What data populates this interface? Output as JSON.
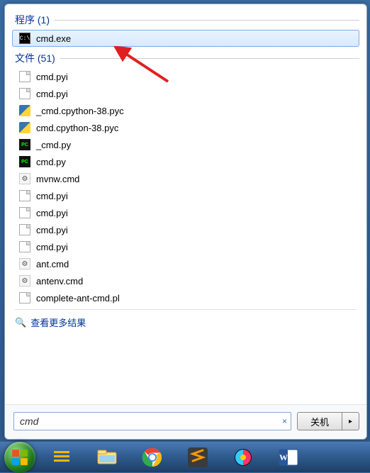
{
  "sections": {
    "programs": {
      "label": "程序 (1)"
    },
    "files": {
      "label": "文件 (51)"
    }
  },
  "programs_list": [
    {
      "name": "cmd.exe",
      "icon": "cmd",
      "selected": true
    }
  ],
  "files_list": [
    {
      "name": "cmd.pyi",
      "icon": "file"
    },
    {
      "name": "cmd.pyi",
      "icon": "file"
    },
    {
      "name": "_cmd.cpython-38.pyc",
      "icon": "py"
    },
    {
      "name": "cmd.cpython-38.pyc",
      "icon": "py"
    },
    {
      "name": "_cmd.py",
      "icon": "pc"
    },
    {
      "name": "cmd.py",
      "icon": "pc"
    },
    {
      "name": "mvnw.cmd",
      "icon": "gear"
    },
    {
      "name": "cmd.pyi",
      "icon": "file"
    },
    {
      "name": "cmd.pyi",
      "icon": "file"
    },
    {
      "name": "cmd.pyi",
      "icon": "file"
    },
    {
      "name": "cmd.pyi",
      "icon": "file"
    },
    {
      "name": "ant.cmd",
      "icon": "gear"
    },
    {
      "name": "antenv.cmd",
      "icon": "gear"
    },
    {
      "name": "complete-ant-cmd.pl",
      "icon": "file"
    }
  ],
  "see_more_label": "查看更多结果",
  "search": {
    "value": "cmd",
    "clear_glyph": "×"
  },
  "shutdown": {
    "label": "关机",
    "arrow_glyph": "▸"
  },
  "taskbar_items": [
    {
      "name": "menu-app",
      "icon": "menu"
    },
    {
      "name": "file-explorer",
      "icon": "explorer"
    },
    {
      "name": "chrome",
      "icon": "chrome"
    },
    {
      "name": "sublime-text",
      "icon": "sublime"
    },
    {
      "name": "colorful-app",
      "icon": "swirl"
    },
    {
      "name": "word",
      "icon": "word"
    }
  ],
  "icon_glyphs": {
    "cmd": "C:\\",
    "pc": "PC",
    "gear": "⚙"
  }
}
